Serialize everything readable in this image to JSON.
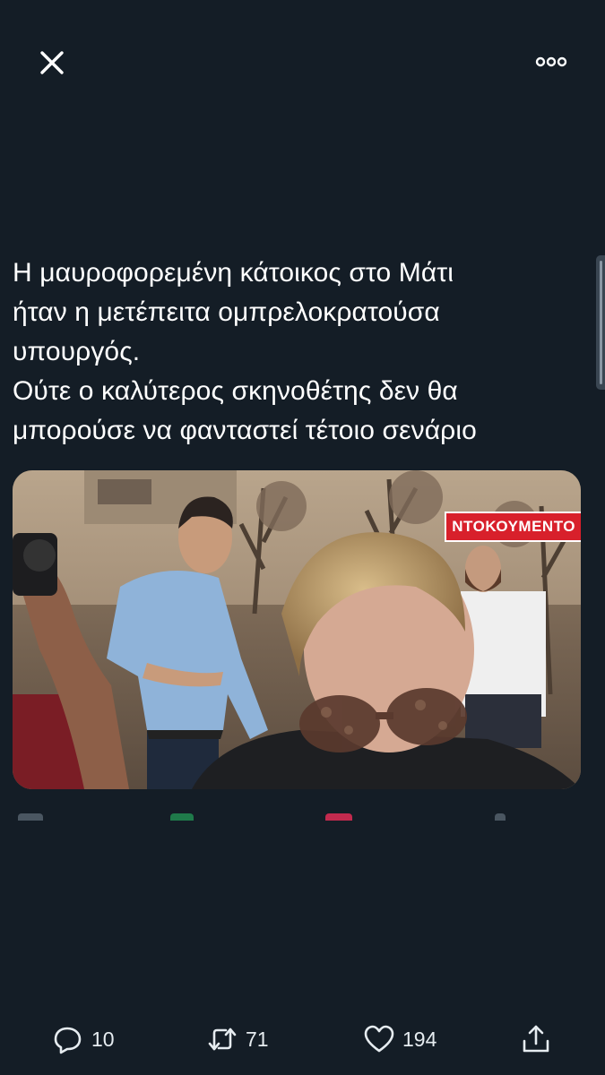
{
  "toolbar": {
    "close_icon": "close-icon",
    "more_icon": "more-options-icon"
  },
  "tweet": {
    "lines": [
      "Η μαυροφορεμένη κάτοικος στο Μάτι",
      "ήταν η μετέπειτα ομπρελοκρατούσα",
      "υπουργός.",
      "Ούτε ο καλύτερος σκηνοθέτης δεν θα",
      "μπορούσε να φανταστεί τέτοιο σενάριο"
    ],
    "media": {
      "news_label": "ΝΤΟΚΟΥΜΕΝΤΟ"
    }
  },
  "actions": {
    "reply": {
      "icon": "reply-icon",
      "count": "10"
    },
    "retweet": {
      "icon": "retweet-icon",
      "count": "71"
    },
    "like": {
      "icon": "heart-icon",
      "count": "194"
    },
    "share": {
      "icon": "share-icon"
    }
  },
  "colors": {
    "background": "#141d26",
    "text": "#ffffff",
    "icon": "#e6ecf0",
    "news_red": "#d8202b"
  }
}
